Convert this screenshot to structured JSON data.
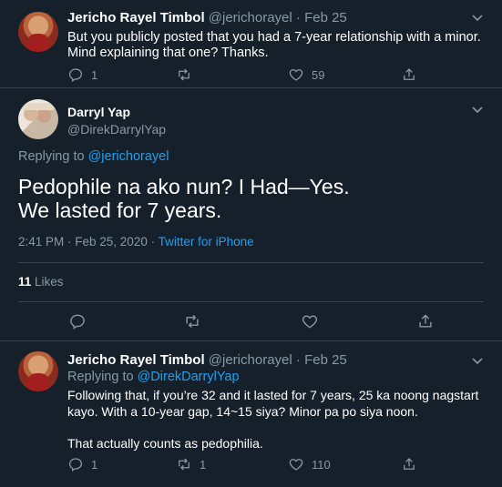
{
  "tweet1": {
    "display_name": "Jericho Rayel Timbol",
    "handle": "@jerichorayel",
    "separator": "·",
    "date": "Feb 25",
    "line1": "But you publicly posted that you had a 7-year relationship with a minor.",
    "line2": "Mind explaining that one? Thanks.",
    "reply_count": "1",
    "retweet_count": "",
    "like_count": "59"
  },
  "main": {
    "display_name": "Darryl Yap",
    "handle": "@DirekDarrylYap",
    "replying_to_label": "Replying to",
    "replying_to_handle": "@jerichorayel",
    "line1": "Pedophile na ako nun? I Had—Yes.",
    "line2": "We lasted for 7 years.",
    "timestamp": "2:41 PM · Feb 25, 2020 · ",
    "source": "Twitter for iPhone",
    "likes_count": "11",
    "likes_label": "Likes"
  },
  "tweet2": {
    "display_name": "Jericho Rayel Timbol",
    "handle": "@jerichorayel",
    "separator": "·",
    "date": "Feb 25",
    "replying_to_label": "Replying to",
    "replying_to_handle": "@DirekDarrylYap",
    "line1": "Following that, if you’re 32 and it lasted for 7 years, 25 ka noong nagstart",
    "line2": "kayo. With a 10-year gap, 14~15 siya? Minor pa po siya noon.",
    "line3": "That actually counts as pedophilia.",
    "reply_count": "1",
    "retweet_count": "1",
    "like_count": "110"
  },
  "colors": {
    "background": "#15202b",
    "divider": "#38444d",
    "muted": "#8899a6",
    "accent": "#1da1f2"
  }
}
